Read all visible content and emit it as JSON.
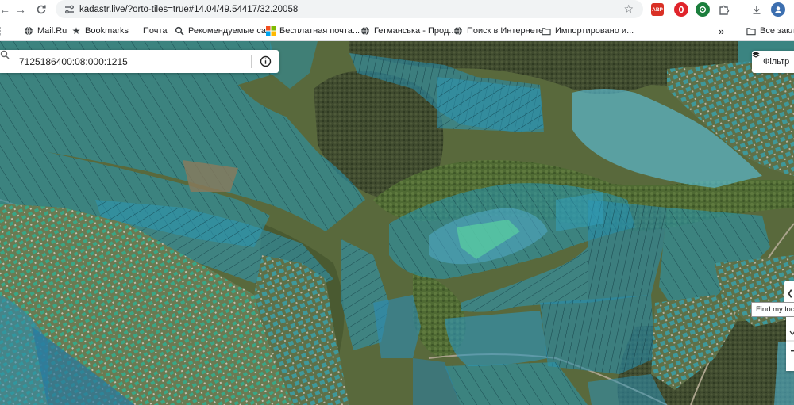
{
  "browser": {
    "url": "kadastr.live/?orto-tiles=true#14.04/49.54417/32.20058",
    "extensions": [
      {
        "name": "adblock-icon",
        "label": "ABP",
        "color": "#d93025"
      },
      {
        "name": "opera-icon",
        "label": "",
        "color": "#e0242b"
      },
      {
        "name": "grammar-icon",
        "label": "",
        "color": "#1b7e3c"
      },
      {
        "name": "puzzle-icon",
        "label": "",
        "color": "#5f6368"
      }
    ]
  },
  "bookmarks": {
    "items": [
      {
        "label": "Mail.Ru",
        "icon": "globe-icon"
      },
      {
        "label": "Bookmarks",
        "icon": "star-icon"
      },
      {
        "label": "Почта",
        "icon": ""
      },
      {
        "label": "Рекомендуемые са...",
        "icon": "search-icon"
      },
      {
        "label": "Бесплатная почта...",
        "icon": "windows-icon"
      },
      {
        "label": "Гетманська - Прод...",
        "icon": "globe-icon"
      },
      {
        "label": "Поиск в Интернете",
        "icon": "globe-icon"
      },
      {
        "label": "Импортировано и...",
        "icon": "folder-icon"
      }
    ],
    "more": "»",
    "all_bookmarks": "Все заклад"
  },
  "map": {
    "search_value": "7125186400:08:000:1215",
    "filter_label": "Фільтр",
    "locate_tooltip": "Find my loca"
  }
}
